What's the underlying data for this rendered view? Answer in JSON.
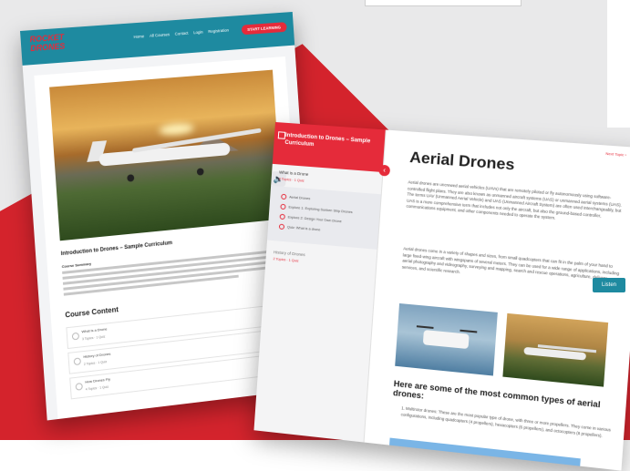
{
  "left_page": {
    "logo_line1": "ROCKET",
    "logo_line2": "DRONES",
    "nav": [
      "Home",
      "All Courses",
      "Contact",
      "Login",
      "Registration"
    ],
    "cta": "START LEARNING",
    "course_title": "Introduction to Drones – Sample Curriculum",
    "summary_label": "Course Summary",
    "content_heading": "Course Content",
    "lessons": [
      {
        "title": "What is a Drone",
        "meta": "3 Topics · 1 Quiz"
      },
      {
        "title": "History of Drones",
        "meta": "2 Topics · 1 Quiz"
      },
      {
        "title": "How Drones Fly",
        "meta": "4 Topics · 1 Quiz"
      }
    ]
  },
  "right_page": {
    "sidebar_title": "Introduction to Drones – Sample Curriculum",
    "section1": {
      "title": "What is a Drone",
      "meta": "3 Topics · 1 Quiz"
    },
    "sub_items": [
      "Aerial Drones",
      "Explore 1: Exploring Sunken Ship Drones",
      "Explore 2: Design Your Own Drone",
      "Quiz: What is a drone"
    ],
    "section2": {
      "title": "History of Drones",
      "meta": "2 Topics · 1 Quiz"
    },
    "next_topic": "Next Topic  ›",
    "heading": "Aerial Drones",
    "para1": "Aerial drones are uncrewed aerial vehicles (UAVs) that are remotely piloted or fly autonomously using software-controlled flight plans. They are also known as unmanned aircraft systems (UAS) or unmanned aerial systems (UAS). The terms UAV (Unmanned Aerial Vehicle) and UAS (Unmanned Aircraft System) are often used interchangeably, but UAS is a more comprehensive term that includes not only the aircraft, but also the ground-based controller, communications equipment, and other components needed to operate the system.",
    "para2": "Aerial drones come in a variety of shapes and sizes, from small quadcopters that can fit in the palm of your hand to large fixed-wing aircraft with wingspans of several meters. They can be used for a wide range of applications, including aerial photography and videography, surveying and mapping, search and rescue operations, agriculture, delivery services, and scientific research.",
    "types_heading": "Here are some of the most common types of aerial drones:",
    "list_item1": "1. Multirotor drones: These are the most popular type of drone, with three or more propellers. They come in various configurations, including quadcopters (4 propellers), hexacopters (6 propellers), and octocopters (8 propellers).",
    "listen": "Listen"
  }
}
